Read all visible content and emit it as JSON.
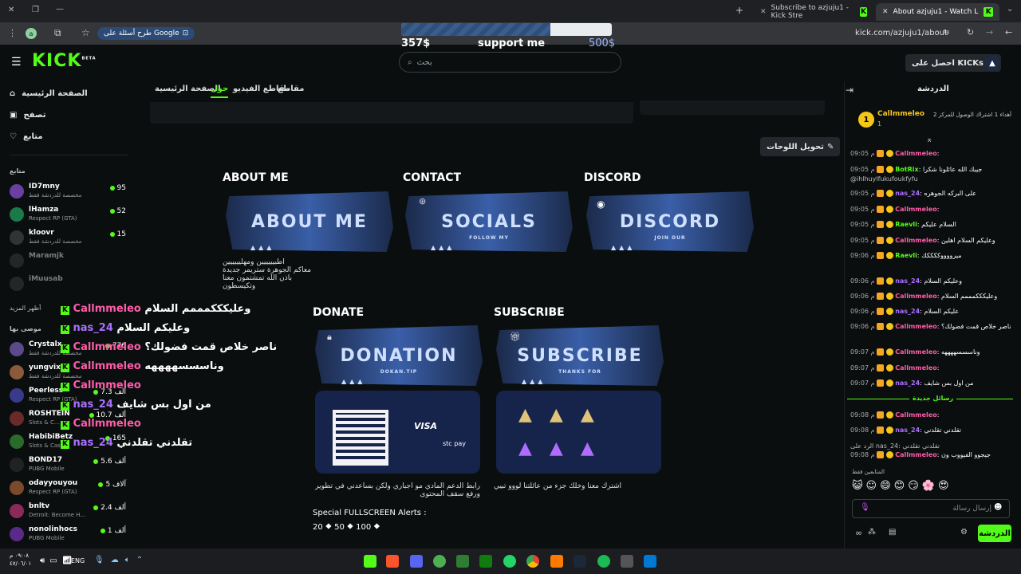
{
  "browser": {
    "tabs": [
      {
        "label": "Subscribe to azjuju1 - Kick Stre",
        "active": false
      },
      {
        "label": "About azjuju1 - Watch Live on",
        "active": true
      }
    ],
    "url": "kick.com/azjuju1/about",
    "google_pill": "طرح أسئلة على Google",
    "avatar_letter": "a"
  },
  "donation_goal": {
    "current": "357$",
    "label": "support me",
    "goal": "500$",
    "progress": 0.71
  },
  "header": {
    "logo": "KICK",
    "logo_sup": "BETA",
    "search_placeholder": "بحث",
    "get_kicks": "احصل على KICKs"
  },
  "sidebar": {
    "nav": [
      {
        "label": "الصفحة الرئيسية",
        "icon": "home-icon"
      },
      {
        "label": "تصفح",
        "icon": "browse-icon"
      },
      {
        "label": "متابع",
        "icon": "heart-icon"
      }
    ],
    "following_heading": "متابع",
    "following": [
      {
        "name": "ID7mny",
        "sub": "مخصصة للدردشة فقط",
        "viewers": "95",
        "color": "#6b3fa0"
      },
      {
        "name": "lHamza",
        "sub": "Respect RP (GTA)",
        "viewers": "52",
        "color": "#1a7a4a"
      },
      {
        "name": "kloovr",
        "sub": "مخصصة للدردشة فقط",
        "viewers": "15",
        "color": "#333333"
      },
      {
        "name": "Maramjk",
        "sub": "",
        "viewers": "",
        "color": "#444444"
      },
      {
        "name": "iMuusab",
        "sub": "",
        "viewers": "",
        "color": "#444444"
      }
    ],
    "show_more": "أظهر المزيد",
    "recommended_heading": "موصى بها",
    "recommended": [
      {
        "name": "Crystalx",
        "sub": "مخصصة للدردشة فقط",
        "viewers": "776",
        "color": "#5a4a8a"
      },
      {
        "name": "yungvix",
        "sub": "مخصصة للدردشة فقط",
        "viewers": "",
        "color": "#8a5a3a"
      },
      {
        "name": "Peerless",
        "sub": "Respect RP (GTA)",
        "viewers": "7.3 ألف",
        "color": "#3a3a8a"
      },
      {
        "name": "ROSHTEIN",
        "sub": "Slots & C...",
        "viewers": "10.7 ألف",
        "color": "#6a2a2a"
      },
      {
        "name": "HabibiBetz",
        "sub": "Slots & Casino",
        "viewers": "165",
        "color": "#2a6a2a"
      },
      {
        "name": "BOND17",
        "sub": "PUBG Mobile",
        "viewers": "5.6 ألف",
        "color": "#222222"
      },
      {
        "name": "odayyouyou",
        "sub": "Respect RP (GTA)",
        "viewers": "5 آلاف",
        "color": "#7a4a2a"
      },
      {
        "name": "bnltv",
        "sub": "Detroit: Become H...",
        "viewers": "2.4 ألف",
        "color": "#8a2a5a"
      },
      {
        "name": "nonolinhocs",
        "sub": "PUBG Mobile",
        "viewers": "1 ألف",
        "color": "#5a2a8a"
      }
    ]
  },
  "profile_tabs": [
    {
      "label": "الصفحة الرئيسية",
      "active": false
    },
    {
      "label": "حول",
      "active": true
    },
    {
      "label": "مقاطع الفيديو",
      "active": false
    },
    {
      "label": "مقاطع",
      "active": false
    }
  ],
  "edit_panels_label": "تحويل اللوحات",
  "panels": {
    "about": {
      "heading": "ABOUT ME",
      "art": "ABOUT ME",
      "desc_lines": [
        "اطبيييييين ومهليييييين",
        "معاكم الجوهرة ستريمر جديدة",
        "باذن الله تمشتمون معنا وتكيسطون"
      ]
    },
    "contact": {
      "heading": "CONTACT",
      "art": "SOCIALS",
      "art_sub": "FOLLOW MY"
    },
    "discord": {
      "heading": "DISCORD",
      "art": "DISCORD",
      "art_sub": "JOIN OUR"
    },
    "donate": {
      "heading": "DONATE",
      "art": "DONATION",
      "art_sub": "DOKAN.TIP",
      "desc": "رابط الدعم المادي مو اجباري ولكن بساعدني في تطوير ورفع سقف المحتوى",
      "extra": "Special FULLSCREEN Alerts :",
      "tiers": "20 ⯁ 50 ⯁ 100 ⯁",
      "pay": [
        "VISA",
        "stc pay"
      ]
    },
    "subscribe": {
      "heading": "SUBSCRIBE",
      "art": "SUBSCRIBE",
      "art_sub": "THANKS FOR",
      "desc": "اشترك معنا وخلك جزء من عائلتنا لووو تبيي"
    }
  },
  "overlay_chat": [
    {
      "user": "Callmmeleo",
      "text": "وعليكككمممم السلام",
      "color": "#ff5ca8"
    },
    {
      "user": "nas_24",
      "text": "وعليكم السلام",
      "color": "#a970ff"
    },
    {
      "user": "Callmmeleo",
      "text": "ناصر خلاص قمت فضولك؟",
      "color": "#ff5ca8"
    },
    {
      "user": "Callmmeleo",
      "text": "وناسسسههههه",
      "color": "#ff5ca8"
    },
    {
      "user": "Callmmeleo",
      "text": "",
      "color": "#ff5ca8"
    },
    {
      "user": "nas_24",
      "text": "من اول بس شايف",
      "color": "#a970ff"
    },
    {
      "user": "Callmmeleo",
      "text": "",
      "color": "#ff5ca8"
    },
    {
      "user": "nas_24",
      "text": "تقلدني تقلدني",
      "color": "#a970ff"
    }
  ],
  "chat": {
    "title": "الدردشة",
    "pinned_user": "Callmmeleo",
    "pinned_sub": "أهداء 1 اشتراك الوصول للمركز 2",
    "pinned_count": "1",
    "messages": [
      {
        "time": "09:05 م",
        "user": "Callmmeleo",
        "text": ":",
        "color": "pink"
      },
      {
        "time": "09:05 م",
        "user": "BotRix",
        "text": ": جيبك الله عائلونا شكرا",
        "color": "green"
      },
      {
        "time": "",
        "user": "",
        "text": "@ihlhuylfukufoukfyfu",
        "color": ""
      },
      {
        "time": "09:05 م",
        "user": "nas_24",
        "text": ": على البركه الجوهره",
        "color": "purp"
      },
      {
        "time": "09:05 م",
        "user": "Callmmeleo",
        "text": ":",
        "color": "pink"
      },
      {
        "time": "09:05 م",
        "user": "Raevli",
        "text": ": السلام عليكم",
        "color": "green"
      },
      {
        "time": "09:05 م",
        "user": "Callmmeleo",
        "text": ": وعليكم السلام اهلين",
        "color": "pink"
      },
      {
        "time": "09:06 م",
        "user": "Raevli",
        "text": ": ميرووووككككك",
        "color": "green"
      },
      {
        "time": "09:06 م",
        "user": "nas_24",
        "text": ": وعليكم السلام",
        "color": "purp"
      },
      {
        "time": "09:06 م",
        "user": "Callmmeleo",
        "text": ": وعليكككمممم السلام",
        "color": "pink"
      },
      {
        "time": "09:06 م",
        "user": "nas_24",
        "text": ": عليكم السلام",
        "color": "purp"
      },
      {
        "time": "09:06 م",
        "user": "Callmmeleo",
        "text": ": ناصر خلاص قمت فضولك؟",
        "color": "pink"
      },
      {
        "time": "09:07 م",
        "user": "Callmmeleo",
        "text": ": وناسسسههههه",
        "color": "pink"
      },
      {
        "time": "09:07 م",
        "user": "Callmmeleo",
        "text": ":",
        "color": "pink"
      },
      {
        "time": "09:07 م",
        "user": "nas_24",
        "text": ": من اول بس شايف",
        "color": "purp"
      },
      {
        "time": "09:08 م",
        "user": "Callmmeleo",
        "text": ":",
        "color": "pink"
      },
      {
        "time": "09:08 م",
        "user": "nas_24",
        "text": ": تقلدني تقلدني",
        "color": "purp"
      },
      {
        "time": "",
        "user": "",
        "text": "الرد على nas_24: تقلدني تقلدني",
        "color": ""
      },
      {
        "time": "09:08 م",
        "user": "Callmmeleo",
        "text": ": جيجوو الفيووب ون",
        "color": "pink"
      }
    ],
    "new_messages": "رسائل جديدة",
    "followers_only": "المتابعين فقط",
    "input_placeholder": "إرسال رسالة",
    "send_label": "الدردشة"
  },
  "taskbar": {
    "lang": "ENG",
    "time": "٠٩:٠٨ م",
    "date": "٤٧/٠٦/٠١"
  }
}
